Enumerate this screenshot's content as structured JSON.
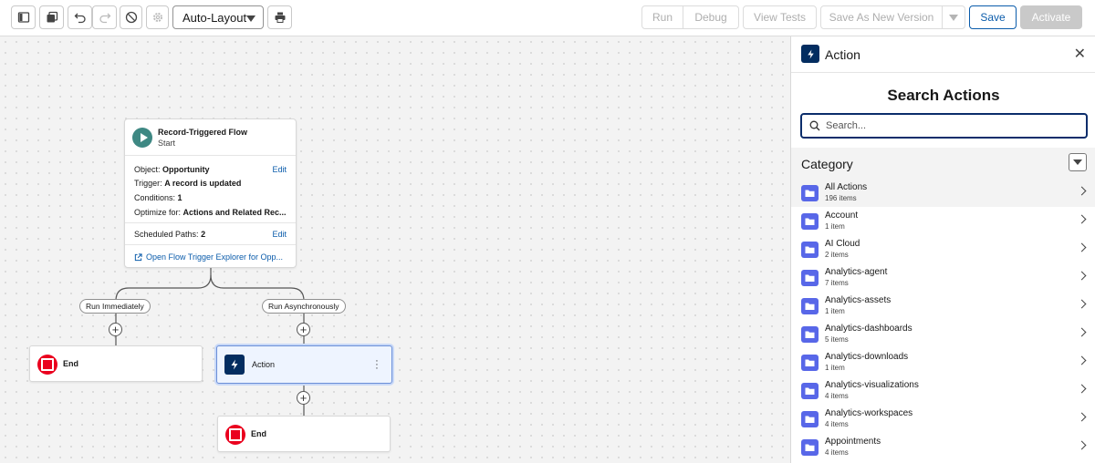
{
  "toolbar": {
    "layout_select": "Auto-Layout",
    "run_label": "Run",
    "debug_label": "Debug",
    "view_tests_label": "View Tests",
    "save_as_new_label": "Save As New Version",
    "save_label": "Save",
    "activate_label": "Activate"
  },
  "start": {
    "title": "Record-Triggered Flow",
    "subtitle": "Start",
    "object_label": "Object:",
    "object_value": "Opportunity",
    "trigger_label": "Trigger:",
    "trigger_value": "A record is updated",
    "conditions_label": "Conditions:",
    "conditions_value": "1",
    "optimize_label": "Optimize for:",
    "optimize_value": "Actions and Related Rec...",
    "scheduled_label": "Scheduled Paths:",
    "scheduled_value": "2",
    "edit_label": "Edit",
    "open_link": "Open Flow Trigger Explorer for Opp..."
  },
  "paths": {
    "immediate": "Run Immediately",
    "async": "Run Asynchronously"
  },
  "nodes": {
    "end_label": "End",
    "action_label": "Action"
  },
  "panel": {
    "header": "Action",
    "search_title": "Search Actions",
    "search_placeholder": "Search...",
    "category_label": "Category",
    "items": [
      {
        "name": "All Actions",
        "count": "196 items"
      },
      {
        "name": "Account",
        "count": "1 item"
      },
      {
        "name": "AI Cloud",
        "count": "2 items"
      },
      {
        "name": "Analytics-agent",
        "count": "7 items"
      },
      {
        "name": "Analytics-assets",
        "count": "1 item"
      },
      {
        "name": "Analytics-dashboards",
        "count": "5 items"
      },
      {
        "name": "Analytics-downloads",
        "count": "1 item"
      },
      {
        "name": "Analytics-visualizations",
        "count": "4 items"
      },
      {
        "name": "Analytics-workspaces",
        "count": "4 items"
      },
      {
        "name": "Appointments",
        "count": "4 items"
      }
    ]
  }
}
